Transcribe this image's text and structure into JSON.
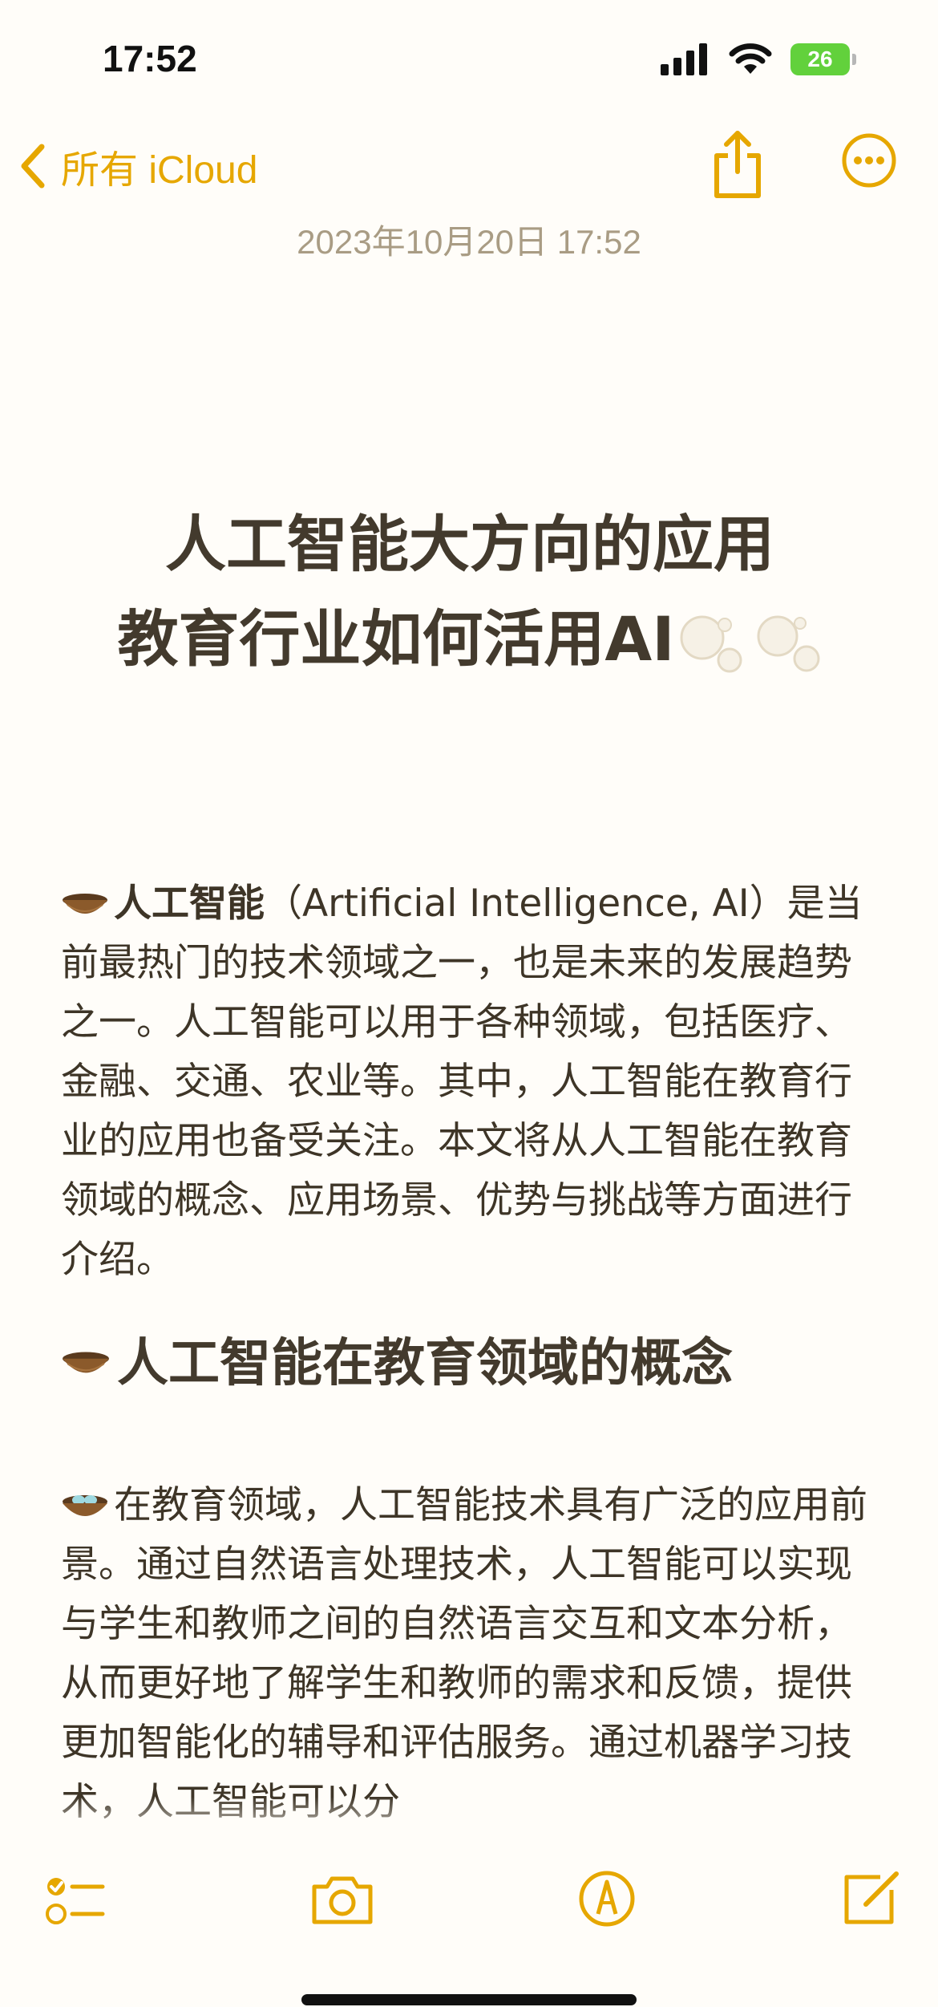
{
  "status_bar": {
    "time": "17:52",
    "battery": "26"
  },
  "nav": {
    "back_label": "所有 iCloud"
  },
  "note": {
    "date": "2023年10月20日 17:52",
    "title_line1": "人工智能大方向的应用",
    "title_line2": "教育行业如何活用AI",
    "p1_bold": "人工智能",
    "p1_text": "（Artificial Intelligence, AI）是当前最热门的技术领域之一，也是未来的发展趋势之一。人工智能可以用于各种领域，包括医疗、金融、交通、农业等。其中，人工智能在教育行业的应用也备受关注。本文将从人工智能在教育领域的概念、应用场景、优势与挑战等方面进行介绍。",
    "heading2": "人工智能在教育领域的概念",
    "p2_text": "在教育领域，人工智能技术具有广泛的应用前景。通过自然语言处理技术，人工智能可以实现与学生和教师之间的自然语言交互和文本分析，从而更好地了解学生和教师的需求和反馈，提供更加智能化的辅导和评估服务。通过机器学习技术，人工智能可以分"
  },
  "colors": {
    "accent": "#e6a700",
    "text": "#3e3527",
    "date": "#a99c84",
    "background": "#fffdf9"
  },
  "icons": [
    "chevron-left-icon",
    "share-icon",
    "more-icon",
    "checklist-icon",
    "camera-icon",
    "markup-icon",
    "compose-icon",
    "nest-icon",
    "nest-with-eggs-icon",
    "bubbles-icon"
  ]
}
